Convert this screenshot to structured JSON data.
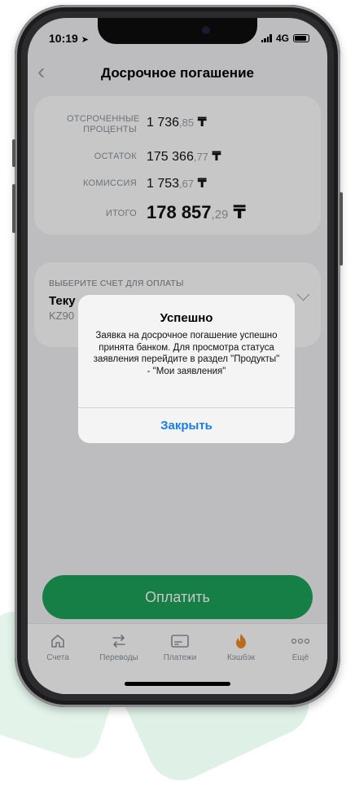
{
  "status": {
    "time": "10:19",
    "network": "4G"
  },
  "header": {
    "title": "Досрочное погашение",
    "back_icon": "‹"
  },
  "summary": {
    "rows": [
      {
        "label": "ОТСРОЧЕННЫЕ ПРОЦЕНТЫ",
        "int": "1 736",
        "dec": ",85",
        "cur": "₸"
      },
      {
        "label": "ОСТАТОК",
        "int": "175 366",
        "dec": ",77",
        "cur": "₸"
      },
      {
        "label": "КОМИССИЯ",
        "int": "1 753",
        "dec": ",67",
        "cur": "₸"
      },
      {
        "label": "ИТОГО",
        "int": "178 857",
        "dec": ",29",
        "cur": "₸"
      }
    ]
  },
  "account": {
    "header": "ВЫБЕРИТЕ СЧЕТ ДЛЯ ОПЛАТЫ",
    "name": "Теку",
    "iban": "KZ90"
  },
  "pay_button": "Оплатить",
  "tabs": [
    {
      "label": "Счета",
      "icon": "home-icon"
    },
    {
      "label": "Переводы",
      "icon": "transfer-icon"
    },
    {
      "label": "Платежи",
      "icon": "payments-icon"
    },
    {
      "label": "Кэшбэк",
      "icon": "cashback-flame-icon"
    },
    {
      "label": "Ещё",
      "icon": "more-icon"
    }
  ],
  "alert": {
    "title": "Успешно",
    "message": "Заявка на досрочное погашение успешно принята банком. Для просмотра статуса заявления перейдите в раздел \"Продукты\" - \"Мои заявления\"",
    "button": "Закрыть"
  },
  "colors": {
    "accent": "#1ba35a",
    "link": "#1a7cf5",
    "cashback": "#f08a24"
  }
}
